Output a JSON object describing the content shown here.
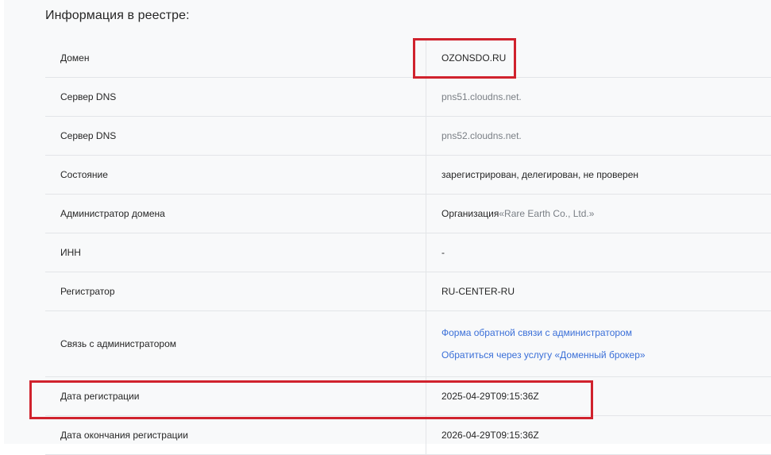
{
  "heading": "Информация в реестре:",
  "rows": [
    {
      "label": "Домен",
      "value": "OZONSDO.RU"
    },
    {
      "label": "Сервер DNS",
      "value": "pns51.cloudns.net."
    },
    {
      "label": "Сервер DNS",
      "value": "pns52.cloudns.net."
    },
    {
      "label": "Состояние",
      "value": "зарегистрирован, делегирован, не проверен"
    },
    {
      "label": "Администратор домена",
      "value_prefix": "Организация ",
      "value_quoted": "«Rare Earth Co., Ltd.»"
    },
    {
      "label": "ИНН",
      "value": "-"
    },
    {
      "label": "Регистратор",
      "value": "RU-CENTER-RU"
    },
    {
      "label": "Связь с администратором",
      "links": [
        "Форма обратной связи с администратором",
        "Обратиться через услугу «Доменный брокер»"
      ]
    },
    {
      "label": "Дата регистрации",
      "value": "2025-04-29T09:15:36Z"
    },
    {
      "label": "Дата окончания регистрации",
      "value": "2026-04-29T09:15:36Z"
    }
  ],
  "colors": {
    "highlight": "#d0222d",
    "link": "#3a6fd8"
  }
}
